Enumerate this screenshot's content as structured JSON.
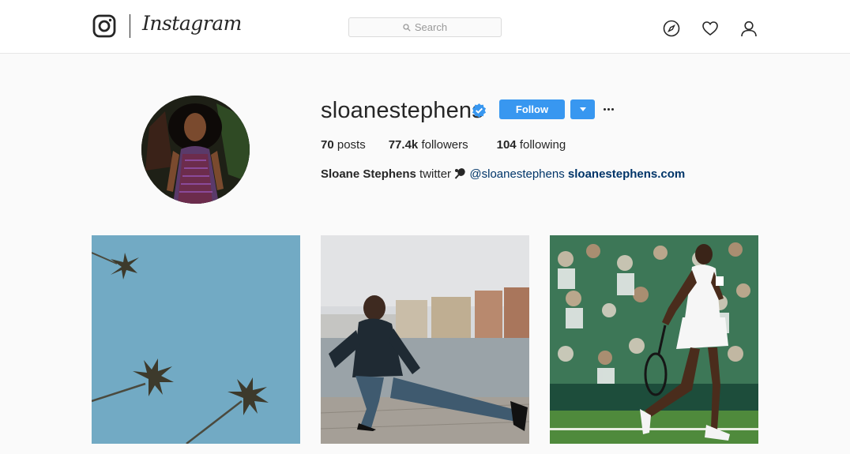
{
  "header": {
    "wordmark": "Instagram",
    "search_placeholder": "Search",
    "icons": [
      "instagram-logo-icon",
      "compass-icon",
      "heart-icon",
      "profile-icon"
    ]
  },
  "profile": {
    "username": "sloanestephens",
    "verified": true,
    "follow_label": "Follow",
    "stats": [
      {
        "value": "70",
        "label": "posts"
      },
      {
        "value": "77.4k",
        "label": "followers"
      },
      {
        "value": "104",
        "label": "following"
      }
    ],
    "bio": {
      "name": "Sloane Stephens",
      "text": "twitter",
      "handle": "@sloanestephens",
      "website": "sloanestephens.com"
    }
  },
  "posts": [
    {
      "subject": "palm-trees-against-sky"
    },
    {
      "subject": "athlete-stretching-on-waterfront"
    },
    {
      "subject": "tennis-player-on-grass-court"
    }
  ],
  "colors": {
    "accent": "#3897f0",
    "link": "#003569",
    "background": "#fafafa",
    "border": "#e6e6e6"
  }
}
